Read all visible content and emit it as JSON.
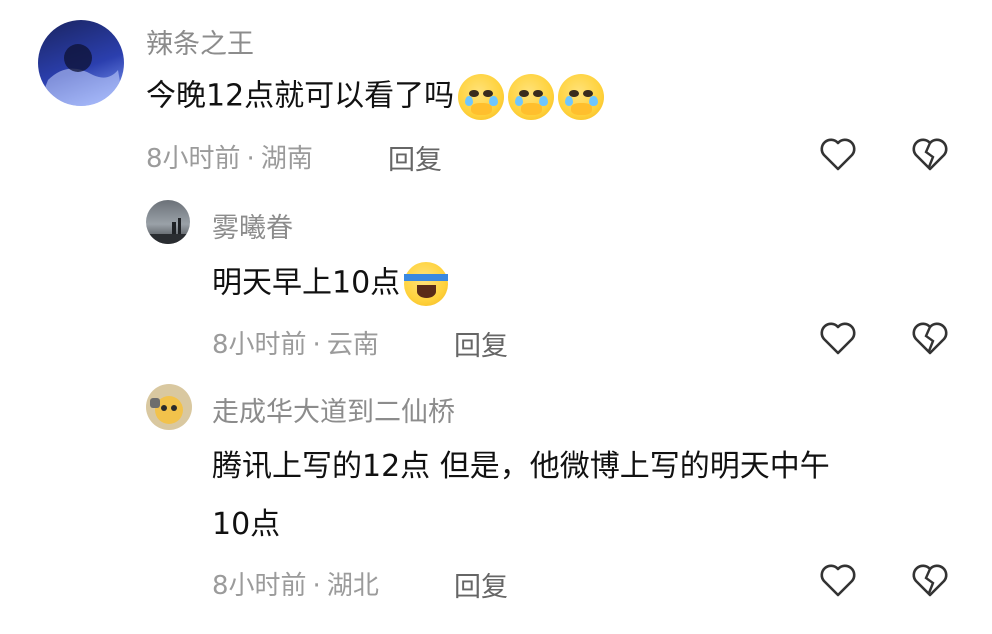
{
  "comments": [
    {
      "username": "辣条之王",
      "text": "今晚12点就可以看了吗",
      "emojis": [
        "pleading-crying-emoji",
        "pleading-crying-emoji",
        "pleading-crying-emoji"
      ],
      "time": "8小时前",
      "location": "湖南",
      "reply_label": "回复"
    },
    {
      "username": "雾曦眷",
      "text": "明天早上10点",
      "emojis": [
        "laughing-crying-emoji"
      ],
      "time": "8小时前",
      "location": "云南",
      "reply_label": "回复"
    },
    {
      "username": "走成华大道到二仙桥",
      "text_line1": "腾讯上写的12点 但是，他微博上写的明天中午",
      "text_line2": "10点",
      "time": "8小时前",
      "location": "湖北",
      "reply_label": "回复"
    }
  ],
  "separator": "·",
  "icons": {
    "like": "heart-outline-icon",
    "dislike": "broken-heart-icon"
  },
  "colors": {
    "text": "#111111",
    "username": "#8c8c8c",
    "meta": "#9b9b9b"
  }
}
